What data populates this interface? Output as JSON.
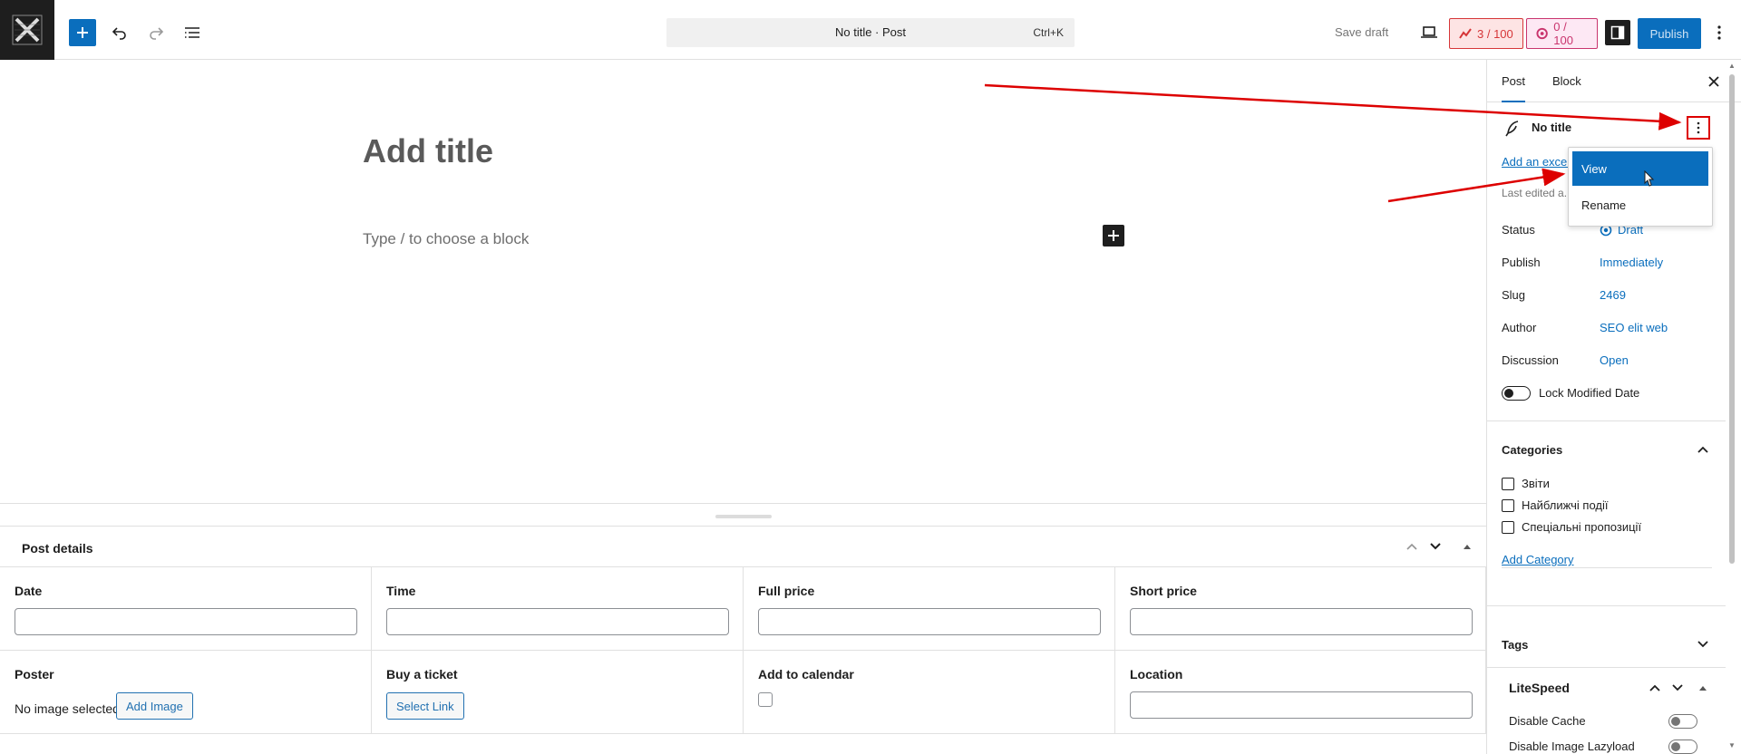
{
  "header": {
    "command_title": "No title · Post",
    "command_shortcut": "Ctrl+K",
    "save_draft": "Save draft",
    "seo_score": "3 / 100",
    "readability_score": "0 / 100",
    "publish": "Publish"
  },
  "editor": {
    "title_placeholder": "Add title",
    "block_placeholder": "Type / to choose a block"
  },
  "metabox": {
    "title": "Post details",
    "fields": {
      "date": "Date",
      "time": "Time",
      "full_price": "Full price",
      "short_price": "Short price",
      "poster": "Poster",
      "poster_status": "No image selected",
      "add_image": "Add Image",
      "buy_ticket": "Buy a ticket",
      "select_link": "Select Link",
      "add_to_calendar": "Add to calendar",
      "location": "Location"
    }
  },
  "sidebar": {
    "tabs": [
      "Post",
      "Block"
    ],
    "post_title": "No title",
    "excerpt_link": "Add an excerpt...",
    "last_edited": "Last edited a...",
    "rows": [
      {
        "label": "Status",
        "value": "Draft"
      },
      {
        "label": "Publish",
        "value": "Immediately"
      },
      {
        "label": "Slug",
        "value": "2469"
      },
      {
        "label": "Author",
        "value": "SEO elit web"
      },
      {
        "label": "Discussion",
        "value": "Open"
      }
    ],
    "lock_modified": "Lock Modified Date",
    "categories_title": "Categories",
    "categories": [
      "Звіти",
      "Найближчі події",
      "Спеціальні пропозиції"
    ],
    "add_category": "Add Category",
    "tags_title": "Tags",
    "litespeed_title": "LiteSpeed",
    "litespeed_rows": [
      "Disable Cache",
      "Disable Image Lazyload"
    ]
  },
  "dropdown": {
    "items": [
      "View",
      "Rename"
    ]
  },
  "colors": {
    "accent": "#0a6ebd",
    "annotation": "#d00000",
    "seo_red": "#d63638"
  }
}
